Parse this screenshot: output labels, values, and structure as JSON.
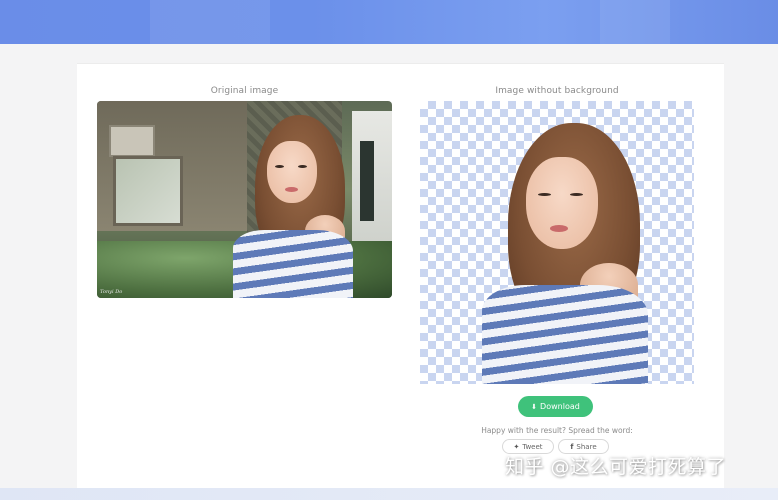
{
  "panels": {
    "left_title": "Original image",
    "right_title": "Image without background"
  },
  "photo": {
    "stamp_text": "Tonyi Do"
  },
  "actions": {
    "download_label": "Download",
    "download_icon": "download-icon",
    "spread_text": "Happy with the result? Spread the word:",
    "tweet_label": "Tweet",
    "tweet_icon": "twitter-icon",
    "share_label": "Share",
    "share_icon": "facebook-icon"
  },
  "watermark": {
    "text": "知乎 @这么可爱打死算了"
  },
  "colors": {
    "header_blue": "#6a8de8",
    "button_green": "#3fc27b",
    "checker_blue": "#c9d5f0",
    "card_bg": "#ffffff",
    "page_bg": "#f4f4f5"
  }
}
